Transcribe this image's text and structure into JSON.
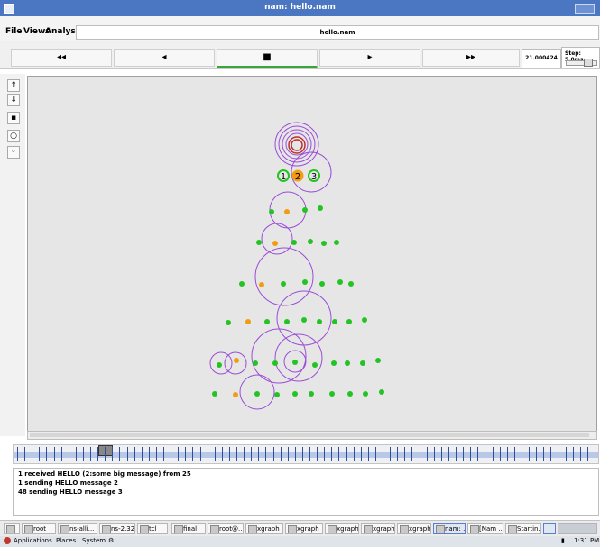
{
  "window": {
    "title": "nam: hello.nam"
  },
  "menu": {
    "file": "File",
    "views": "Views",
    "analysis": "Analysis",
    "filename": "hello.nam"
  },
  "controls": {
    "rewind": "◂◂",
    "back": "◂",
    "stop": "■",
    "play": "▸",
    "fastforward": "▸▸",
    "time": "21.000424",
    "step_label": "Step: 5.0ms"
  },
  "log": [
    "1 received HELLO (2:some big message) from 25",
    "1 sending HELLO message 2",
    "48 sending HELLO message 3"
  ],
  "canvas": {
    "node_labels": [
      "1",
      "2",
      "3"
    ],
    "colors": {
      "node_green": "#22c322",
      "node_orange": "#f39c12",
      "ring_purple": "#9b4dd6",
      "center_red": "#c03030"
    }
  },
  "taskbar": {
    "items": [
      "root",
      "ns-alli...",
      "ns-2.32",
      "tcl",
      "final",
      "root@...",
      "xgraph",
      "xgraph",
      "xgraph",
      "xgraph",
      "xgraph",
      "nam: ...",
      "[Nam ...",
      "Startin..."
    ]
  },
  "bottombar": {
    "applications": "Applications",
    "places": "Places",
    "system": "System",
    "clock": "1:31 PM"
  }
}
